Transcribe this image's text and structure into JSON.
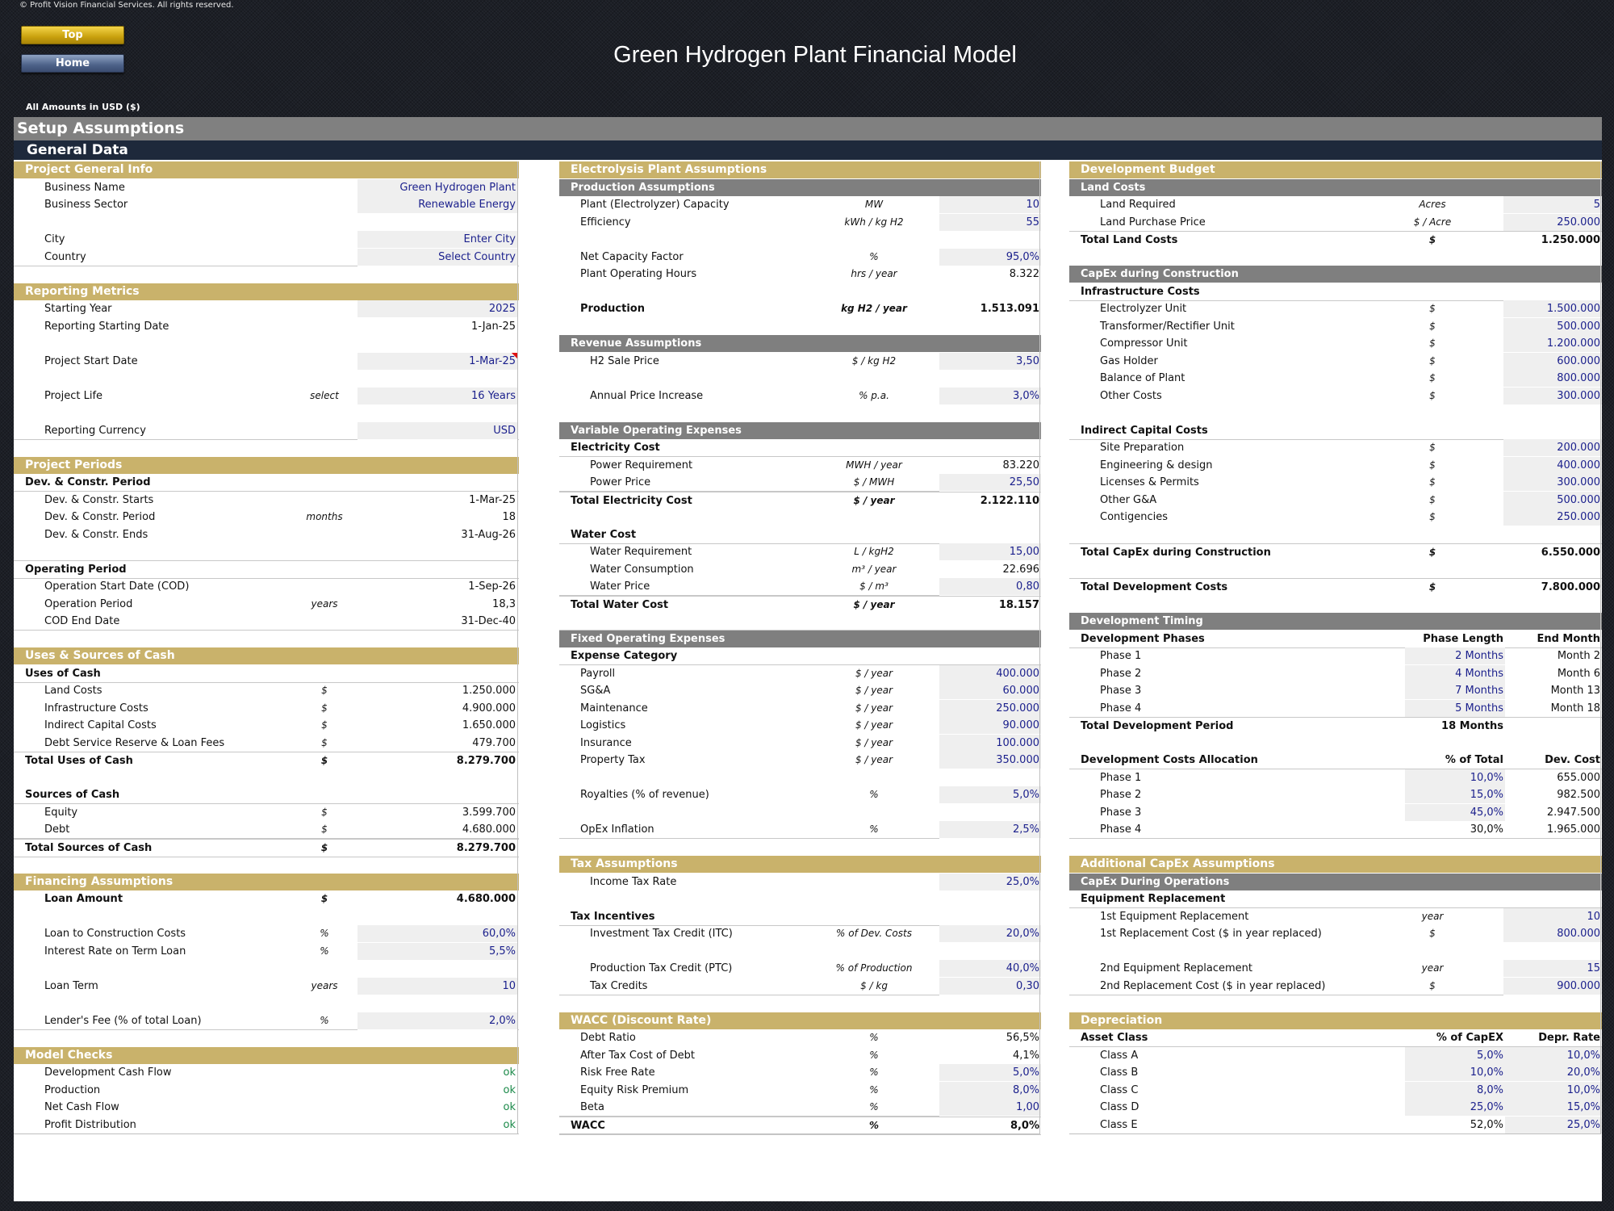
{
  "copyright": "© Profit Vision Financial Services. All rights reserved.",
  "nav": {
    "top_label": "Top",
    "home_label": "Home"
  },
  "title": "Green Hydrogen Plant Financial Model",
  "amounts_note": "All Amounts in  USD ($)",
  "section_title": "Setup Assumptions",
  "subsection_title": "General Data",
  "colors": {
    "gold_header": "#c9b26b",
    "grey_header": "#7f7f7f",
    "navy_band": "#1e293b",
    "input_text": "#1a1f8c",
    "input_bg": "#efefef",
    "ok_text": "#1c8a4a"
  },
  "left": [
    {
      "type": "gold",
      "label": "Project General Info"
    },
    {
      "label": "Business Name",
      "value": "Green Hydrogen Plant",
      "input": "text"
    },
    {
      "label": "Business Sector",
      "value": "Renewable Energy",
      "input": "text"
    },
    {
      "type": "blank"
    },
    {
      "label": "City",
      "value": "Enter City",
      "input": true
    },
    {
      "label": "Country",
      "value": "Select Country",
      "input": true,
      "end": true
    },
    {
      "type": "gap"
    },
    {
      "type": "gold",
      "label": "Reporting Metrics"
    },
    {
      "label": "Starting Year",
      "value": "2025",
      "input": true
    },
    {
      "label": "Reporting Starting Date",
      "value": "1-Jan-25"
    },
    {
      "type": "blank"
    },
    {
      "label": "Project Start Date",
      "value": "1-Mar-25",
      "input": true,
      "flag": true,
      "tall": true
    },
    {
      "type": "blank"
    },
    {
      "label": "Project Life",
      "unit": "select",
      "value": "16 Years",
      "input": true,
      "tall": true
    },
    {
      "type": "blank"
    },
    {
      "label": "Reporting Currency",
      "value": "USD",
      "input": true,
      "end": true,
      "tall": true
    },
    {
      "type": "gap"
    },
    {
      "type": "gold",
      "label": "Project Periods"
    },
    {
      "type": "sub",
      "label": "Dev. & Constr. Period"
    },
    {
      "label": "Dev. & Constr. Starts",
      "value": "1-Mar-25"
    },
    {
      "label": "Dev. & Constr. Period",
      "unit": "months",
      "value": "18"
    },
    {
      "label": "Dev. & Constr. Ends",
      "value": "31-Aug-26"
    },
    {
      "type": "blank",
      "end": true
    },
    {
      "type": "sub",
      "label": "Operating Period"
    },
    {
      "label": "Operation Start Date (COD)",
      "value": "1-Sep-26"
    },
    {
      "label": "Operation Period",
      "unit": "years",
      "value": "18,3"
    },
    {
      "label": "COD End Date",
      "value": "31-Dec-40",
      "end": true
    },
    {
      "type": "gap"
    },
    {
      "type": "gold",
      "label": "Uses & Sources of Cash"
    },
    {
      "type": "sub",
      "label": "Uses of Cash"
    },
    {
      "label": "Land Costs",
      "unit": "$",
      "value": "1.250.000"
    },
    {
      "label": "Infrastructure Costs",
      "unit": "$",
      "value": "4.900.000"
    },
    {
      "label": "Indirect Capital Costs",
      "unit": "$",
      "value": "1.650.000"
    },
    {
      "label": "Debt Service Reserve & Loan Fees",
      "unit": "$",
      "value": "479.700",
      "end": true
    },
    {
      "type": "total",
      "label": "Total Uses of Cash",
      "unit": "$",
      "value": "8.279.700"
    },
    {
      "type": "blank"
    },
    {
      "type": "sub",
      "label": "Sources of Cash"
    },
    {
      "label": "Equity",
      "unit": "$",
      "value": "3.599.700"
    },
    {
      "label": "Debt",
      "unit": "$",
      "value": "4.680.000",
      "end": true
    },
    {
      "type": "total",
      "label": "Total Sources of Cash",
      "unit": "$",
      "value": "8.279.700",
      "end": true
    },
    {
      "type": "gap"
    },
    {
      "type": "gold",
      "label": "Financing Assumptions"
    },
    {
      "label": "Loan Amount",
      "unit": "$",
      "value": "4.680.000",
      "bold": true
    },
    {
      "type": "blank"
    },
    {
      "label": "Loan to Construction Costs",
      "unit": "%",
      "value": "60,0%",
      "input": true,
      "tall": true
    },
    {
      "label": "Interest Rate on Term Loan",
      "unit": "%",
      "value": "5,5%",
      "input": true
    },
    {
      "type": "blank"
    },
    {
      "label": "Loan Term",
      "unit": "years",
      "value": "10",
      "input": true,
      "tall": true
    },
    {
      "type": "blank"
    },
    {
      "label": "Lender's Fee (% of total Loan)",
      "unit": "%",
      "value": "2,0%",
      "input": true,
      "end": true,
      "tall": true
    },
    {
      "type": "gap"
    },
    {
      "type": "gold",
      "label": "Model Checks"
    },
    {
      "label": "Development Cash Flow",
      "value": "ok",
      "ok": true
    },
    {
      "label": "Production",
      "value": "ok",
      "ok": true
    },
    {
      "label": "Net Cash Flow",
      "value": "ok",
      "ok": true
    },
    {
      "label": "Profit Distribution",
      "value": "ok",
      "ok": true,
      "end": true
    }
  ],
  "middle": [
    {
      "type": "gold",
      "label": "Electrolysis Plant Assumptions"
    },
    {
      "type": "grey",
      "label": "Production Assumptions"
    },
    {
      "label": "Plant (Electrolyzer) Capacity",
      "unit": "MW",
      "value": "10",
      "input": true
    },
    {
      "label": "Efficiency",
      "unit": "kWh / kg H2",
      "value": "55",
      "input": true
    },
    {
      "type": "blank"
    },
    {
      "label": "Net Capacity Factor",
      "unit": "%",
      "value": "95,0%",
      "input": true
    },
    {
      "label": "Plant Operating Hours",
      "unit": "hrs / year",
      "value": "8.322"
    },
    {
      "type": "blank"
    },
    {
      "label": "Production",
      "unit": "kg H2 / year",
      "value": "1.513.091",
      "bold": true
    },
    {
      "type": "blank"
    },
    {
      "type": "grey",
      "label": "Revenue Assumptions"
    },
    {
      "label": "H2 Sale Price",
      "unit": "$ / kg H2",
      "value": "3,50",
      "input": true,
      "indent": true
    },
    {
      "type": "blank"
    },
    {
      "label": "Annual Price Increase",
      "unit": "% p.a.",
      "value": "3,0%",
      "input": true,
      "indent": true,
      "tall": true
    },
    {
      "type": "blank"
    },
    {
      "type": "grey",
      "label": "Variable Operating Expenses"
    },
    {
      "type": "sub",
      "label": "Electricity Cost"
    },
    {
      "label": "Power Requirement",
      "unit": "MWH / year",
      "value": "83.220",
      "indent": true
    },
    {
      "label": "Power Price",
      "unit": "$ / MWH",
      "value": "25,50",
      "input": true,
      "indent": true,
      "end": true
    },
    {
      "type": "total",
      "label": "Total Electricity Cost",
      "unit": "$ / year",
      "value": "2.122.110"
    },
    {
      "type": "blank"
    },
    {
      "type": "sub",
      "label": "Water Cost"
    },
    {
      "label": "Water Requirement",
      "unit": "L / kgH2",
      "value": "15,00",
      "input": true,
      "indent": true
    },
    {
      "label": "Water Consumption",
      "unit": "m³ / year",
      "value": "22.696",
      "indent": true
    },
    {
      "label": "Water Price",
      "unit": "$ / m³",
      "value": "0,80",
      "input": true,
      "indent": true,
      "end": true
    },
    {
      "type": "total",
      "label": "Total Water Cost",
      "unit": "$ / year",
      "value": "18.157"
    },
    {
      "type": "blank",
      "end": true
    },
    {
      "type": "grey",
      "label": "Fixed Operating Expenses"
    },
    {
      "type": "sub",
      "label": "Expense Category"
    },
    {
      "label": "Payroll",
      "unit": "$ / year",
      "value": "400.000",
      "input": true
    },
    {
      "label": "SG&A",
      "unit": "$ / year",
      "value": "60.000",
      "input": true
    },
    {
      "label": "Maintenance",
      "unit": "$ / year",
      "value": "250.000",
      "input": true
    },
    {
      "label": "Logistics",
      "unit": "$ / year",
      "value": "90.000",
      "input": true
    },
    {
      "label": "Insurance",
      "unit": "$ / year",
      "value": "100.000",
      "input": true
    },
    {
      "label": "Property Tax",
      "unit": "$ / year",
      "value": "350.000",
      "input": true
    },
    {
      "type": "blank"
    },
    {
      "label": "Royalties (% of revenue)",
      "unit": "%",
      "value": "5,0%",
      "input": true,
      "tall": true
    },
    {
      "type": "blank"
    },
    {
      "label": "OpEx Inflation",
      "unit": "%",
      "value": "2,5%",
      "input": true,
      "end": true,
      "tall": true
    },
    {
      "type": "gap"
    },
    {
      "type": "gold",
      "label": "Tax Assumptions"
    },
    {
      "label": "Income Tax Rate",
      "value": "25,0%",
      "input": true,
      "indent": true
    },
    {
      "type": "blank"
    },
    {
      "type": "sub",
      "label": "Tax Incentives"
    },
    {
      "label": "Investment Tax Credit (ITC)",
      "unit": "% of Dev. Costs",
      "value": "20,0%",
      "input": true,
      "indent": true
    },
    {
      "type": "blank"
    },
    {
      "label": "Production Tax Credit (PTC)",
      "unit": "% of Production",
      "value": "40,0%",
      "input": true,
      "indent": true,
      "tall": true
    },
    {
      "label": "Tax Credits",
      "unit": "$ / kg",
      "value": "0,30",
      "input": true,
      "indent": true,
      "end": true
    },
    {
      "type": "gap"
    },
    {
      "type": "gold",
      "label": "WACC (Discount Rate)"
    },
    {
      "label": "Debt Ratio",
      "unit": "%",
      "value": "56,5%"
    },
    {
      "label": "After Tax Cost of Debt",
      "unit": "%",
      "value": "4,1%"
    },
    {
      "label": "Risk Free Rate",
      "unit": "%",
      "value": "5,0%",
      "input": true
    },
    {
      "label": "Equity Risk Premium",
      "unit": "%",
      "value": "8,0%",
      "input": true
    },
    {
      "label": "Beta",
      "unit": "%",
      "value": "1,00",
      "input": true,
      "end": true
    },
    {
      "type": "total",
      "label": "WACC",
      "unit": "%",
      "value": "8,0%",
      "end": true
    }
  ],
  "right": [
    {
      "type": "gold",
      "label": "Development Budget"
    },
    {
      "type": "grey",
      "label": "Land Costs"
    },
    {
      "label": "Land Required",
      "unit": "Acres",
      "value": "5",
      "input": true,
      "indent": true
    },
    {
      "label": "Land Purchase Price",
      "unit": "$ / Acre",
      "value": "250.000",
      "input": true,
      "indent": true,
      "end": true
    },
    {
      "type": "total",
      "label": "Total Land Costs",
      "unit": "$",
      "value": "1.250.000"
    },
    {
      "type": "blank"
    },
    {
      "type": "grey",
      "label": "CapEx during Construction"
    },
    {
      "type": "sub",
      "label": "Infrastructure Costs"
    },
    {
      "label": "Electrolyzer Unit",
      "unit": "$",
      "value": "1.500.000",
      "input": true,
      "indent": true
    },
    {
      "label": "Transformer/Rectifier Unit",
      "unit": "$",
      "value": "500.000",
      "input": true,
      "indent": true
    },
    {
      "label": "Compressor Unit",
      "unit": "$",
      "value": "1.200.000",
      "input": true,
      "indent": true
    },
    {
      "label": "Gas Holder",
      "unit": "$",
      "value": "600.000",
      "input": true,
      "indent": true
    },
    {
      "label": "Balance of Plant",
      "unit": "$",
      "value": "800.000",
      "input": true,
      "indent": true
    },
    {
      "label": "Other Costs",
      "unit": "$",
      "value": "300.000",
      "input": true,
      "indent": true
    },
    {
      "type": "blank"
    },
    {
      "type": "sub",
      "label": "Indirect Capital Costs"
    },
    {
      "label": "Site Preparation",
      "unit": "$",
      "value": "200.000",
      "input": true,
      "indent": true
    },
    {
      "label": "Engineering & design",
      "unit": "$",
      "value": "400.000",
      "input": true,
      "indent": true
    },
    {
      "label": "Licenses & Permits",
      "unit": "$",
      "value": "300.000",
      "input": true,
      "indent": true
    },
    {
      "label": "Other G&A",
      "unit": "$",
      "value": "500.000",
      "input": true,
      "indent": true
    },
    {
      "label": "Contigencies",
      "unit": "$",
      "value": "250.000",
      "input": true,
      "indent": true
    },
    {
      "type": "blank",
      "end": true
    },
    {
      "type": "total",
      "label": "Total CapEx during Construction",
      "unit": "$",
      "value": "6.550.000"
    },
    {
      "type": "blank",
      "end": true
    },
    {
      "type": "total",
      "label": "Total Development Costs",
      "unit": "$",
      "value": "7.800.000"
    },
    {
      "type": "blank"
    },
    {
      "type": "grey",
      "label": "Development Timing"
    },
    {
      "type": "hdr",
      "label": "Development Phases",
      "col1": "Phase Length",
      "col2": "End Month"
    },
    {
      "label": "Phase 1",
      "v1": "2 Months",
      "v1input": true,
      "v2": "Month 2",
      "indent": true
    },
    {
      "label": "Phase 2",
      "v1": "4 Months",
      "v1input": true,
      "v2": "Month 6",
      "indent": true
    },
    {
      "label": "Phase 3",
      "v1": "7 Months",
      "v1input": true,
      "v2": "Month 13",
      "indent": true
    },
    {
      "label": "Phase 4",
      "v1": "5 Months",
      "v1input": true,
      "v2": "Month 18",
      "indent": true,
      "end": true
    },
    {
      "type": "total2",
      "label": "Total Development Period",
      "v1": "18 Months"
    },
    {
      "type": "blank"
    },
    {
      "type": "hdr",
      "label": "Development Costs Allocation",
      "col1": "% of Total",
      "col2": "Dev. Cost"
    },
    {
      "label": "Phase 1",
      "v1": "10,0%",
      "v1input": true,
      "v2": "655.000",
      "indent": true,
      "tall": true
    },
    {
      "label": "Phase 2",
      "v1": "15,0%",
      "v1input": true,
      "v2": "982.500",
      "indent": true
    },
    {
      "label": "Phase 3",
      "v1": "45,0%",
      "v1input": true,
      "v2": "2.947.500",
      "indent": true
    },
    {
      "label": "Phase 4",
      "v1": "30,0%",
      "v2": "1.965.000",
      "indent": true,
      "end": true
    },
    {
      "type": "gap"
    },
    {
      "type": "gold",
      "label": "Additional CapEx Assumptions"
    },
    {
      "type": "grey",
      "label": "CapEx During Operations"
    },
    {
      "type": "sub",
      "label": "Equipment Replacement"
    },
    {
      "label": "1st Equipment Replacement",
      "unit": "year",
      "value": "10",
      "input": true,
      "indent": true
    },
    {
      "label": "1st Replacement Cost  ($ in year replaced)",
      "unit": "$",
      "value": "800.000",
      "input": true,
      "indent": true
    },
    {
      "type": "blank"
    },
    {
      "label": "2nd Equipment Replacement",
      "unit": "year",
      "value": "15",
      "input": true,
      "indent": true,
      "tall": true
    },
    {
      "label": "2nd Replacement Cost  ($ in year replaced)",
      "unit": "$",
      "value": "900.000",
      "input": true,
      "indent": true,
      "end": true
    },
    {
      "type": "gap"
    },
    {
      "type": "gold",
      "label": "Depreciation"
    },
    {
      "type": "hdr",
      "label": "Asset Class",
      "col1": "% of CapEX",
      "col2": "Depr. Rate"
    },
    {
      "label": "Class A",
      "v1": "5,0%",
      "v1input": true,
      "v2": "10,0%",
      "v2input": true,
      "indent": true
    },
    {
      "label": "Class B",
      "v1": "10,0%",
      "v1input": true,
      "v2": "20,0%",
      "v2input": true,
      "indent": true
    },
    {
      "label": "Class C",
      "v1": "8,0%",
      "v1input": true,
      "v2": "10,0%",
      "v2input": true,
      "indent": true
    },
    {
      "label": "Class D",
      "v1": "25,0%",
      "v1input": true,
      "v2": "15,0%",
      "v2input": true,
      "indent": true
    },
    {
      "label": "Class E",
      "v1": "52,0%",
      "v2": "25,0%",
      "v2input": true,
      "indent": true,
      "end": true
    }
  ]
}
